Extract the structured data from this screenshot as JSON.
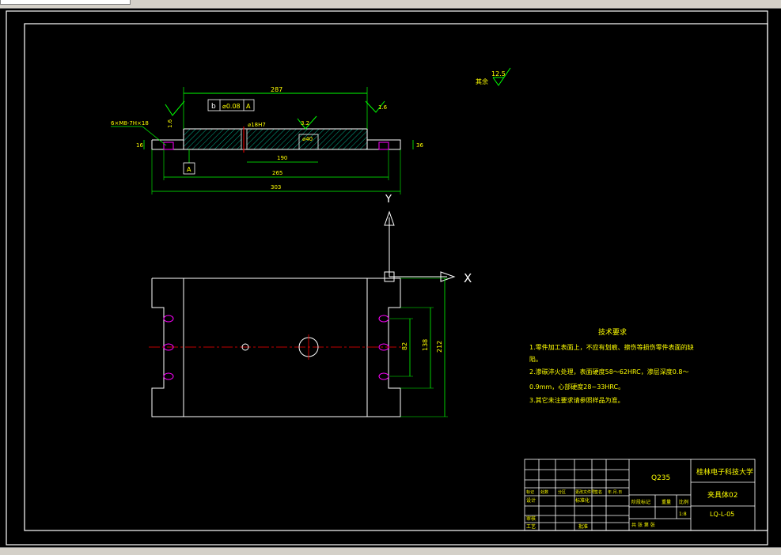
{
  "drawing": {
    "roughness_note": {
      "value": "12.5",
      "label": "其余"
    },
    "section_view": {
      "top_dim": "287",
      "tolerance_frame": {
        "symbol": "b",
        "value": "⌀0.08",
        "datum": "A"
      },
      "roughness_left": "1.6",
      "roughness_mid": "3.2",
      "roughness_right": "1.6",
      "roughness_top_left": "1.6",
      "thread_callout": "6×M8-7H×18",
      "hole_label_1": "⌀18H7",
      "hole_label_2": "⌀40",
      "height_left": "16",
      "height_right": "36",
      "dim_190": "190",
      "dim_265": "265",
      "dim_overall": "303",
      "datum_label": "A"
    },
    "axis_y": "Y",
    "axis_x": "X",
    "plan_view": {
      "dim_inner": "82",
      "dim_mid": "138",
      "dim_outer": "212"
    },
    "tech_req": {
      "title": "技术要求",
      "lines": [
        "1.零件加工表面上，不应有划痕、擦伤等损伤零件表面的缺",
        "陷。",
        "2.渗碳淬火处理，表面硬度58～62HRC，渗层深度0.8～",
        "0.9mm，心部硬度28~33HRC。",
        "3.其它未注要求请参照样品为准。"
      ]
    },
    "title_block": {
      "material": "Q235",
      "school": "桂林电子科技大学",
      "part_name": "夹具体02",
      "drawing_no": "LQ-L-05",
      "scale_label": "比例",
      "scale_value": "1:8",
      "weight_label": "重量",
      "stage_label": "阶段标记",
      "sheets_text": "共 张  第 张",
      "row_labels": [
        "标记",
        "处数",
        "分区",
        "更改文件号",
        "签名",
        "年.月.日"
      ],
      "left_labels": [
        "设计",
        "审核",
        "工艺"
      ],
      "std_label": "标准化",
      "approve_label": "批准"
    },
    "colors": {
      "background": "#000000",
      "frame": "#ffffff",
      "dimension": "#00ff00",
      "centerline": "#ff0000",
      "thread": "#ff00ff",
      "hatch": "#00aa88"
    }
  }
}
